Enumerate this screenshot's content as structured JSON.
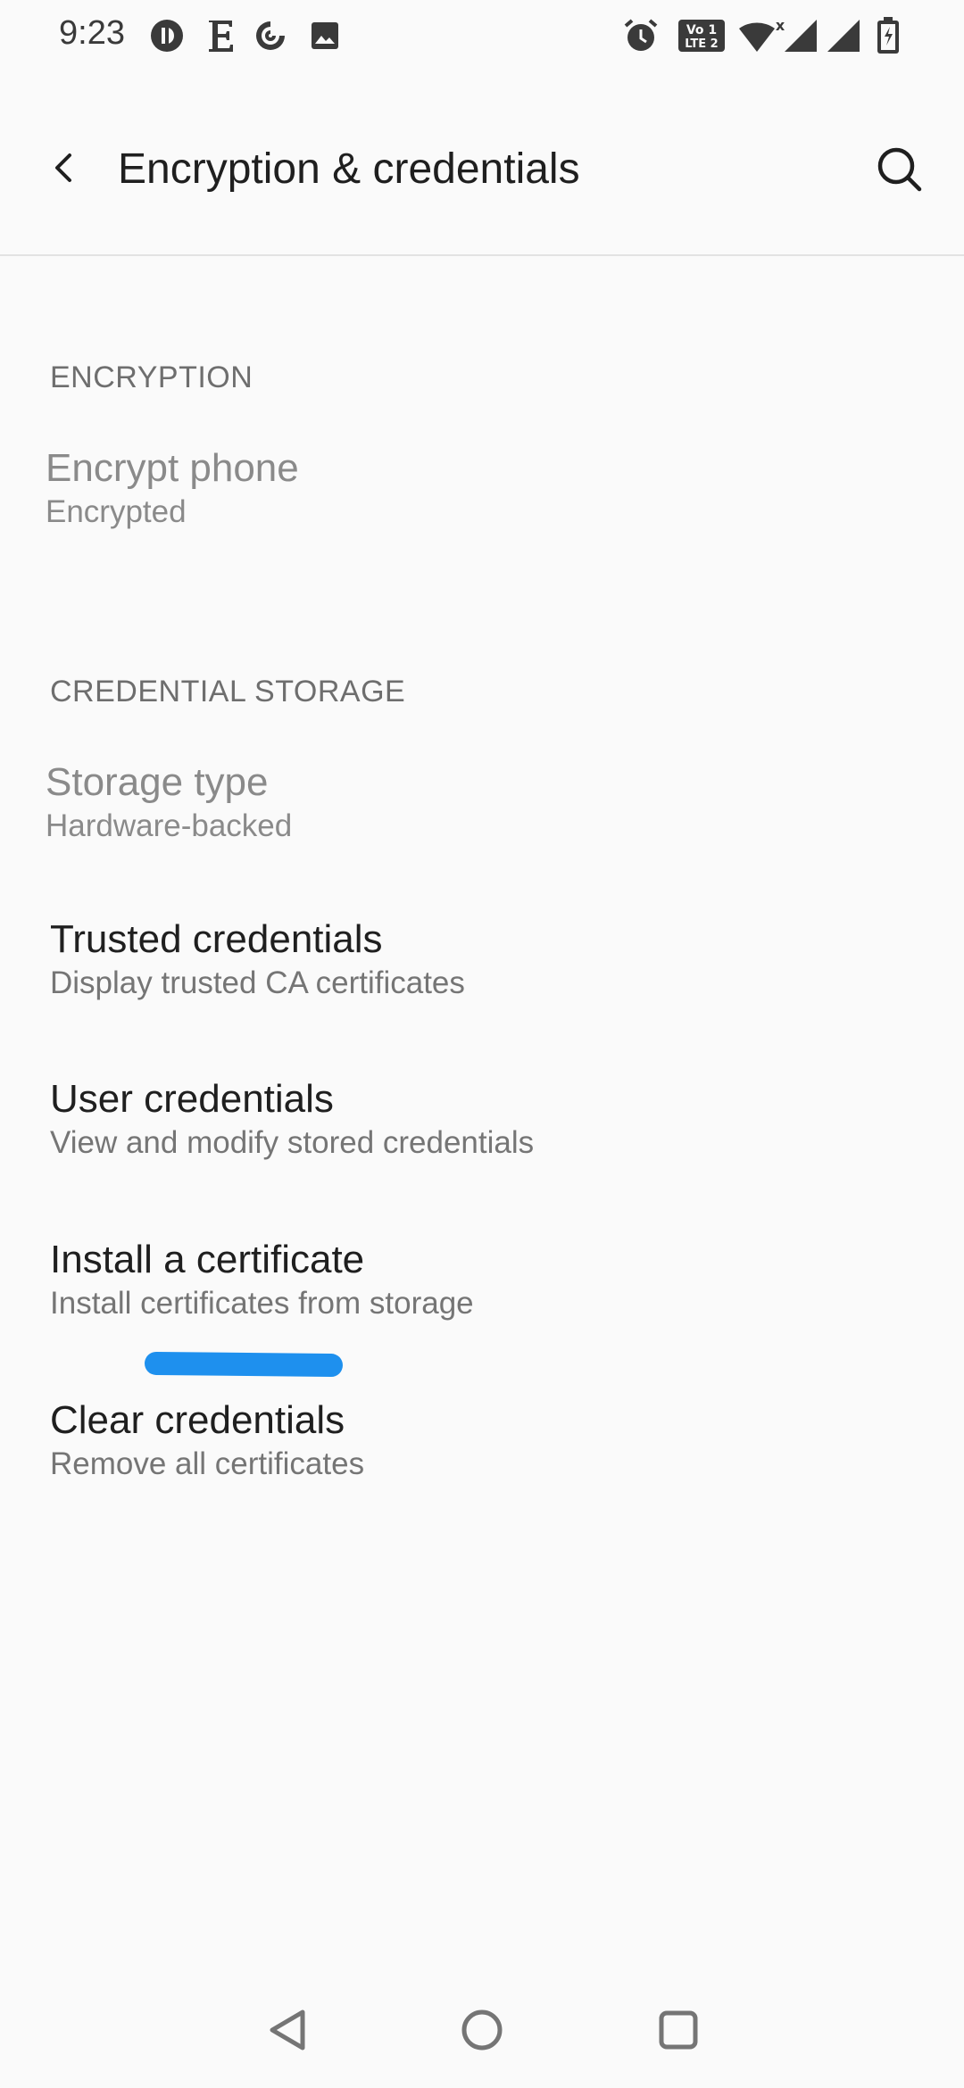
{
  "status_bar": {
    "time": "9:23",
    "left_icons": [
      "threads-icon",
      "e-icon",
      "ring-icon",
      "gallery-icon"
    ],
    "right_icons": [
      "alarm-icon",
      "volte-icon",
      "wifi-icon",
      "signal-icon",
      "signal-icon",
      "battery-charging-icon"
    ],
    "volte_label": "Vo LTE"
  },
  "app_bar": {
    "title": "Encryption & credentials",
    "back_icon": "back-arrow-icon",
    "search_icon": "search-icon"
  },
  "sections": {
    "encryption": {
      "header": "ENCRYPTION",
      "items": [
        {
          "title": "Encrypt phone",
          "summary": "Encrypted",
          "enabled": false
        }
      ]
    },
    "credential_storage": {
      "header": "CREDENTIAL STORAGE",
      "items": [
        {
          "title": "Storage type",
          "summary": "Hardware-backed",
          "enabled": false
        },
        {
          "title": "Trusted credentials",
          "summary": "Display trusted CA certificates",
          "enabled": true
        },
        {
          "title": "User credentials",
          "summary": "View and modify stored credentials",
          "enabled": true
        },
        {
          "title": "Install a certificate",
          "summary": "Install certificates from storage",
          "enabled": true
        },
        {
          "title": "Clear credentials",
          "summary": "Remove all certificates",
          "enabled": true
        }
      ]
    }
  },
  "annotation": {
    "highlight_color": "#1e90ee"
  },
  "nav_bar": {
    "buttons": [
      "nav-back-icon",
      "nav-home-icon",
      "nav-recents-icon"
    ]
  }
}
